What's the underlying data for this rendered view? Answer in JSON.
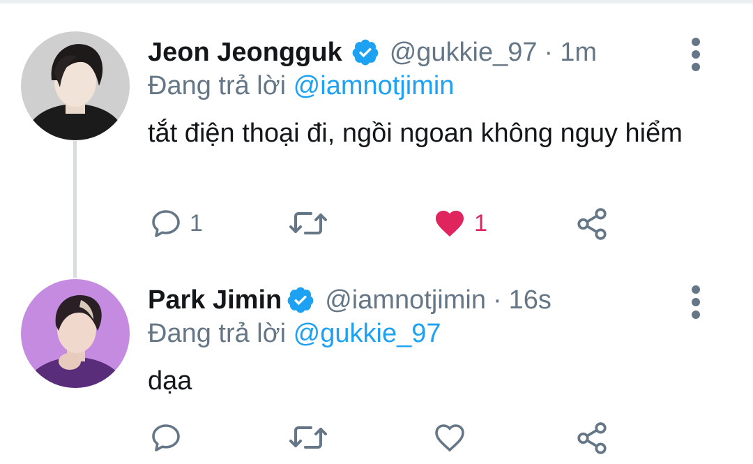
{
  "tweets": [
    {
      "name": "Jeon Jeongguk",
      "handle": "@gukkie_97",
      "separator": "·",
      "time": "1m",
      "reply_prefix": "Đang trả lời",
      "reply_mention": "@iamnotjimin",
      "text": "tắt điện thoại đi, ngồi ngoan không nguy hiểm",
      "reply_count": "1",
      "like_count": "1",
      "liked": true,
      "avatar_icon": "avatar-photo"
    },
    {
      "name": "Park Jimin",
      "handle": "@iamnotjimin",
      "separator": "·",
      "time": "16s",
      "reply_prefix": "Đang trả lời",
      "reply_mention": "@gukkie_97",
      "text": "dạa",
      "reply_count": "",
      "like_count": "",
      "liked": false,
      "avatar_icon": "avatar-photo"
    }
  ],
  "colors": {
    "accent": "#1da1f2",
    "like": "#e0245e",
    "secondary": "#657786",
    "primary_text": "#14171a"
  },
  "icons": {
    "reply": "comment-bubble-icon",
    "retweet": "retweet-icon",
    "like": "heart-icon",
    "share": "share-icon",
    "verified": "verified-badge-icon",
    "more": "more-vertical-icon"
  }
}
